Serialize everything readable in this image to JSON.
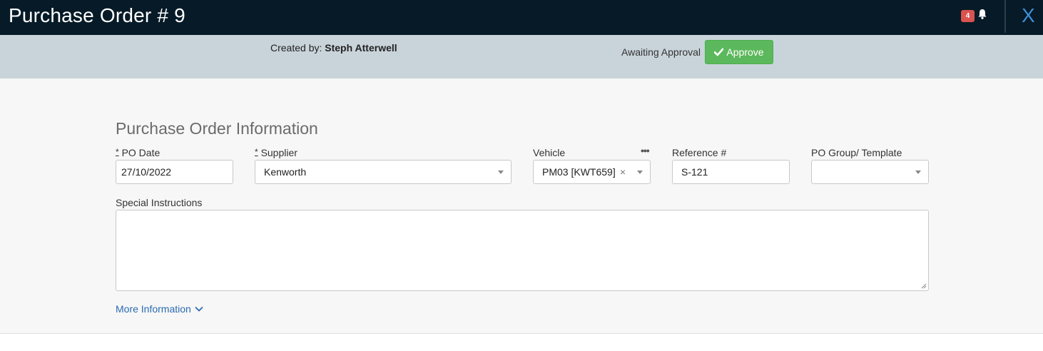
{
  "header": {
    "title": "Purchase Order # 9",
    "notification_count": "4",
    "close_label": "X"
  },
  "infobar": {
    "created_by_label": "Created by:",
    "created_by_name": "Steph Atterwell",
    "status_text": "Awaiting Approval",
    "approve_label": "Approve"
  },
  "form": {
    "section_title": "Purchase Order Information",
    "required_marker": "*",
    "po_date": {
      "label": "PO Date",
      "value": "27/10/2022"
    },
    "supplier": {
      "label": "Supplier",
      "value": "Kenworth"
    },
    "vehicle": {
      "label": "Vehicle",
      "value": "PM03 [KWT659]",
      "more_label": "•••"
    },
    "reference": {
      "label": "Reference #",
      "value": "S-121"
    },
    "po_group": {
      "label": "PO Group/ Template",
      "value": ""
    },
    "special_instructions": {
      "label": "Special Instructions",
      "value": ""
    },
    "more_information_label": "More Information"
  },
  "colors": {
    "topbar": "#061a27",
    "infobar": "#c9d4da",
    "approve": "#5cb85c",
    "badge": "#d9534f",
    "link": "#2a6bb0",
    "close": "#3d8fd8"
  }
}
